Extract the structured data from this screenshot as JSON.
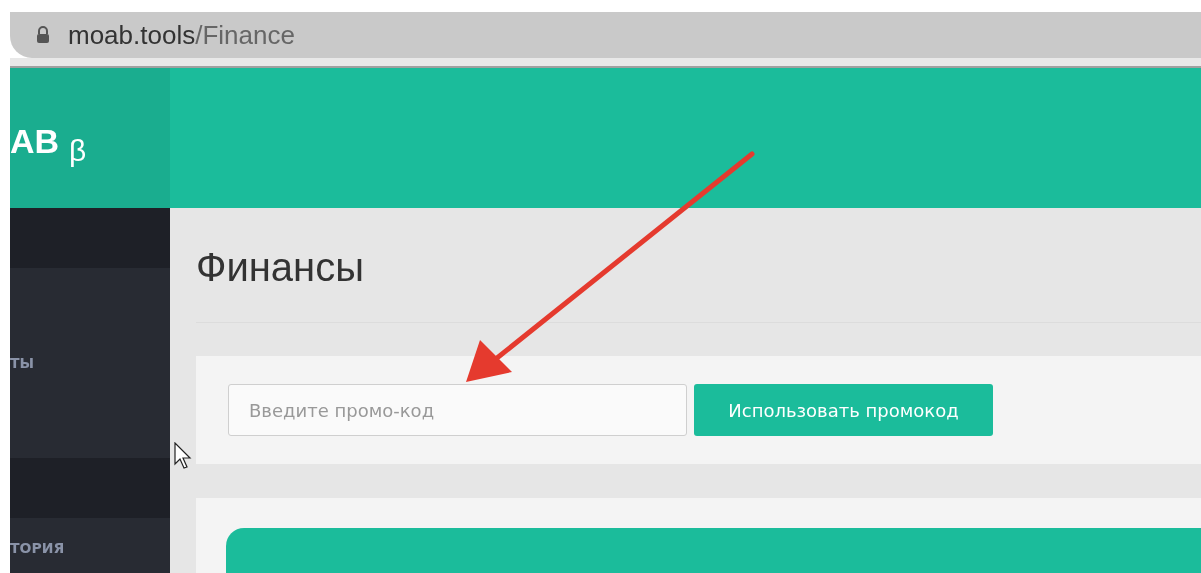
{
  "address_bar": {
    "url_host": "moab.tools",
    "url_path": "/Finance"
  },
  "logo": {
    "text": "AB",
    "badge": "β"
  },
  "sidebar": {
    "items": [
      {
        "label": "ТЫ",
        "kind": "tall"
      },
      {
        "label": "ТОРИЯ",
        "kind": "tall"
      }
    ]
  },
  "page_title": "Финансы",
  "promo": {
    "placeholder": "Введите промо-код",
    "button": "Использовать промокод"
  }
}
